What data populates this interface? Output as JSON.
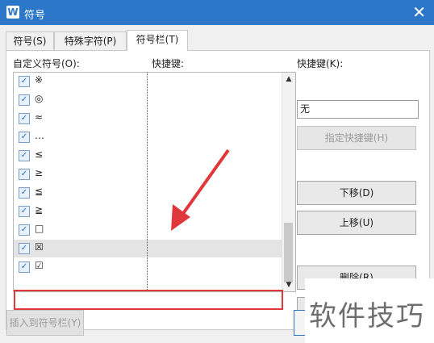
{
  "window": {
    "title": "符号",
    "app_icon_letter": "W",
    "close_glyph": "✕"
  },
  "tabs": [
    {
      "label": "符号(S)",
      "active": false
    },
    {
      "label": "特殊字符(P)",
      "active": false
    },
    {
      "label": "符号栏(T)",
      "active": true
    }
  ],
  "list": {
    "header_symbol": "自定义符号(O):",
    "header_shortcut": "快捷键:",
    "rows": [
      {
        "symbol": "※",
        "checked": true,
        "shortcut": ""
      },
      {
        "symbol": "◎",
        "checked": true,
        "shortcut": ""
      },
      {
        "symbol": "≈",
        "checked": true,
        "shortcut": ""
      },
      {
        "symbol": "…",
        "checked": true,
        "shortcut": ""
      },
      {
        "symbol": "≤",
        "checked": true,
        "shortcut": ""
      },
      {
        "symbol": "≥",
        "checked": true,
        "shortcut": ""
      },
      {
        "symbol": "≦",
        "checked": true,
        "shortcut": ""
      },
      {
        "symbol": "≧",
        "checked": true,
        "shortcut": ""
      },
      {
        "symbol": "□",
        "checked": true,
        "shortcut": ""
      },
      {
        "symbol": "☒",
        "checked": true,
        "shortcut": "",
        "selected": true
      },
      {
        "symbol": "☑",
        "checked": true,
        "shortcut": ""
      }
    ]
  },
  "right_panel": {
    "shortcut_label": "快捷键(K):",
    "shortcut_value": "无",
    "assign_button": "指定快捷键(H)",
    "down_button": "下移(D)",
    "up_button": "上移(U)",
    "delete_button": "删除(R)"
  },
  "footer": {
    "insert_button": "插入到符号栏(Y)"
  },
  "watermark": "软件技巧",
  "colors": {
    "titlebar": "#2d77c8",
    "highlight": "#e0373a",
    "arrow": "#e0373a"
  }
}
